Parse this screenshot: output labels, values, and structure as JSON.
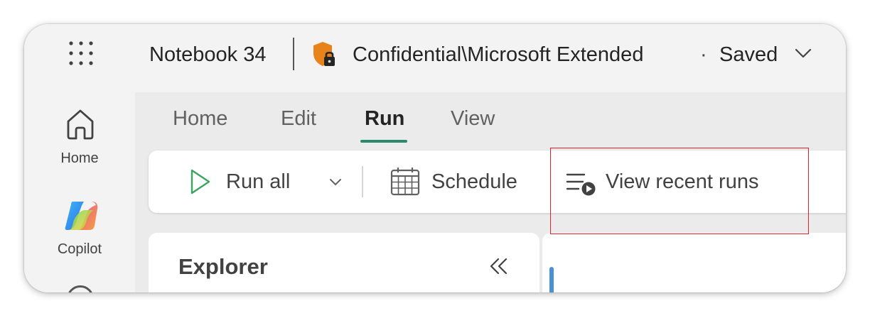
{
  "titlebar": {
    "app_launcher_icon": "waffle-grid-icon",
    "notebook_name": "Notebook 34",
    "sensitivity_icon": "shield-lock-icon",
    "sensitivity_label": "Confidential\\Microsoft Extended",
    "separator_dot": "·",
    "save_status": "Saved",
    "save_menu_icon": "chevron-down-icon"
  },
  "left_rail": {
    "items": [
      {
        "icon": "home-icon",
        "label": "Home"
      },
      {
        "icon": "copilot-icon",
        "label": "Copilot"
      }
    ]
  },
  "tabs": [
    {
      "label": "Home",
      "active": false
    },
    {
      "label": "Edit",
      "active": false
    },
    {
      "label": "Run",
      "active": true
    },
    {
      "label": "View",
      "active": false
    }
  ],
  "ribbon": {
    "run_all_label": "Run all",
    "run_all_icon": "play-icon",
    "run_all_menu_icon": "chevron-down-icon",
    "schedule_label": "Schedule",
    "schedule_icon": "calendar-icon",
    "view_recent_runs_label": "View recent runs",
    "view_recent_runs_icon": "list-play-icon"
  },
  "explorer": {
    "title": "Explorer",
    "collapse_icon": "double-chevron-left-icon"
  },
  "colors": {
    "accent_green": "#2b8a6e",
    "highlight_red": "#e0202a",
    "shield_orange": "#e8821b",
    "editor_blue": "#4a90d9"
  }
}
